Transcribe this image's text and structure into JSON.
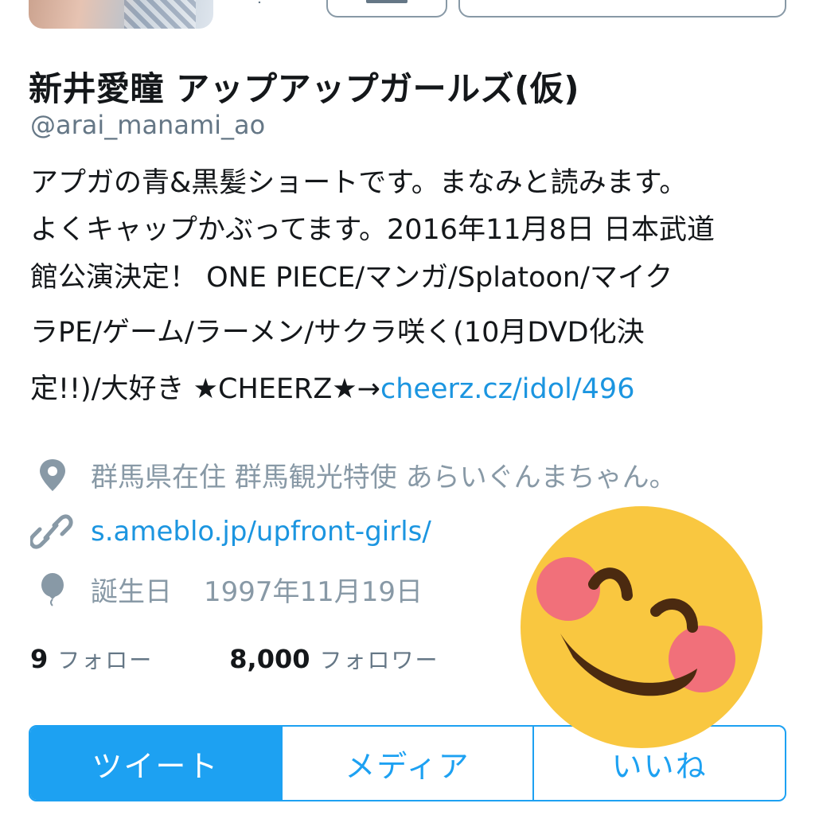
{
  "profile": {
    "display_name": "新井愛瞳 アップアップガールズ(仮)",
    "handle": "@arai_manami_ao",
    "bio": {
      "line1": "アプガの青&黒髪ショートです。まなみと読みます。",
      "line2": "よくキャップかぶってます。2016年11月8日 日本武道",
      "line3": "館公演決定！ ONE PIECE/マンガ/Splatoon/マイク",
      "line4": "ラPE/ゲーム/ラーメン/サクラ咲く(10月DVD化決",
      "line5_text": "定!!)/大好き ★CHEERZ★→",
      "line5_link": "cheerz.cz/idol/496"
    },
    "location": "群馬県在住 群馬観光特使 あらいぐんまちゃん。",
    "website": "s.ameblo.jp/upfront-girls/",
    "birthday_label": "誕生日",
    "birthday_value": "1997年11月19日"
  },
  "stats": {
    "following_count": "9",
    "following_label": "フォロー",
    "followers_count": "8,000",
    "followers_label": "フォロワー"
  },
  "tabs": [
    {
      "label": "ツイート",
      "active": true
    },
    {
      "label": "メディア",
      "active": false
    },
    {
      "label": "いいね",
      "active": false
    }
  ],
  "icons": {
    "location": "location-pin-icon",
    "link": "link-icon",
    "birthday": "balloon-icon",
    "sticker": "smiling-face-emoji"
  },
  "colors": {
    "accent": "#1da1f2",
    "link": "#1b95e0",
    "secondary_text": "#657786",
    "meta_text": "#8899a6",
    "emoji_face": "#f9c740",
    "emoji_cheek": "#f1707a"
  }
}
